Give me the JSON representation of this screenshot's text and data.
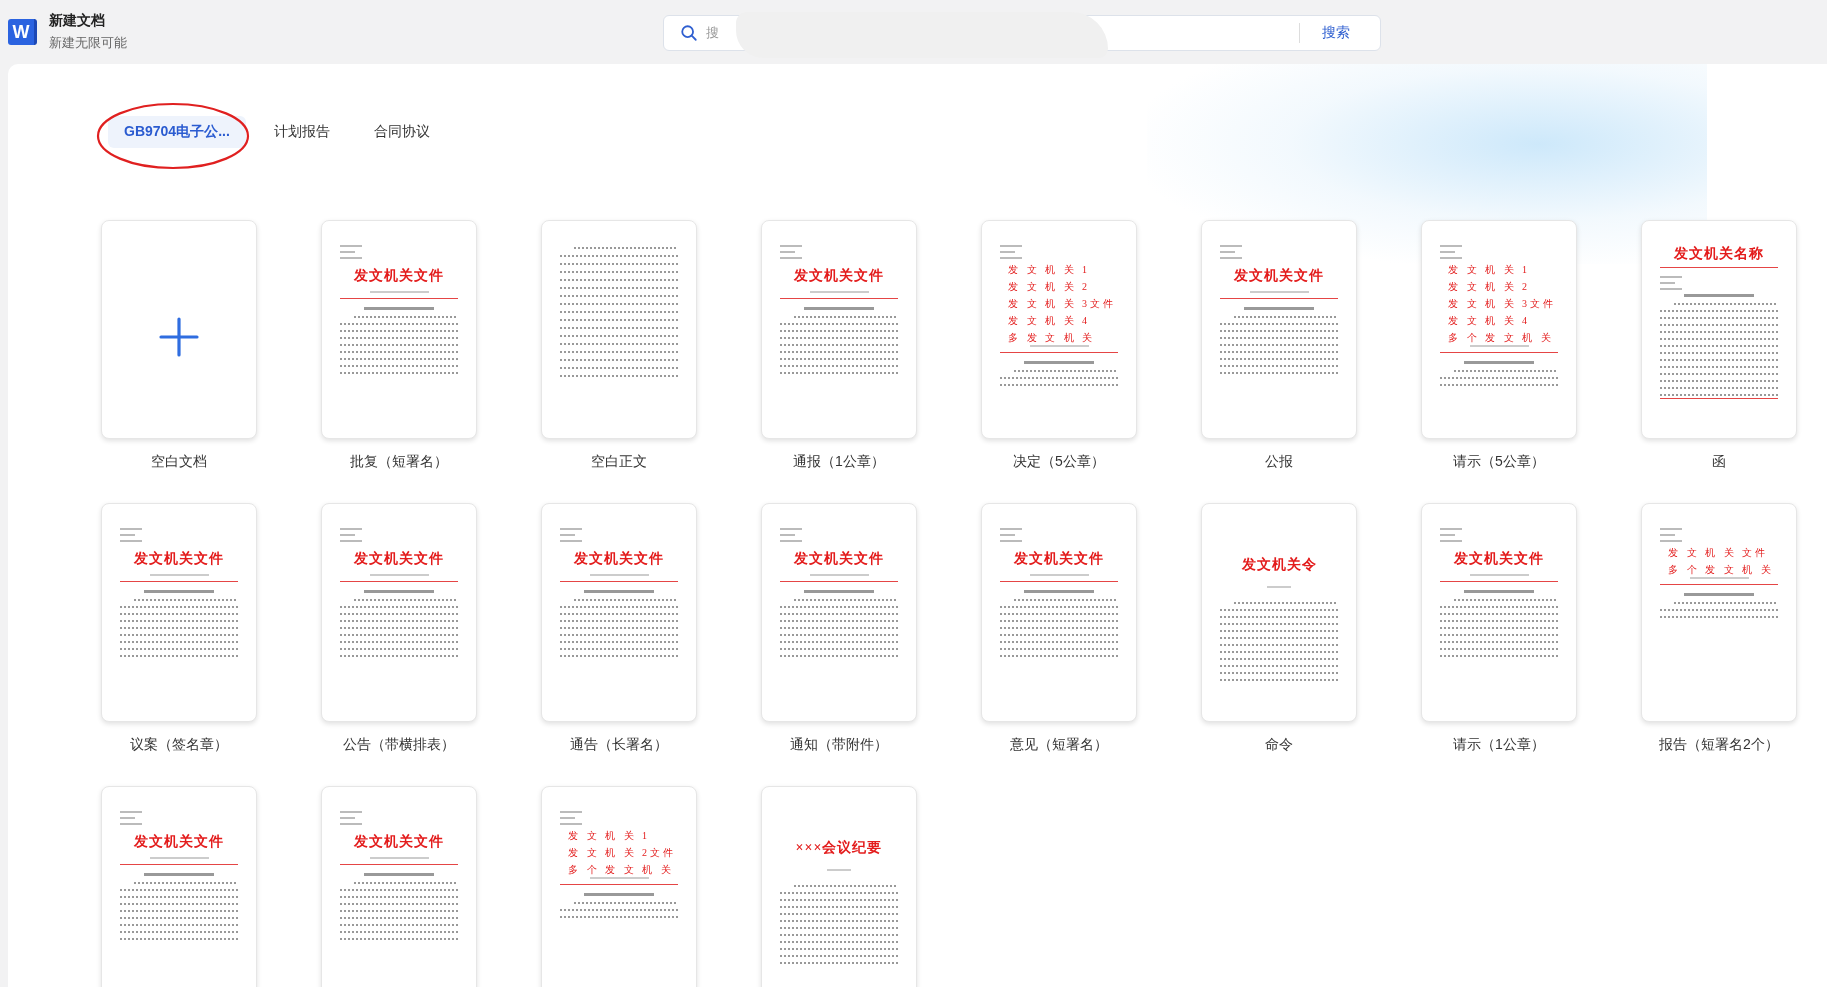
{
  "app": {
    "title": "新建文档",
    "subtitle": "新建无限可能",
    "logo": "W"
  },
  "search": {
    "placeholder": "搜",
    "button": "搜索"
  },
  "tabs": [
    {
      "label": "GB9704电子公...",
      "selected": true,
      "circled": true
    },
    {
      "label": "计划报告",
      "selected": false,
      "circled": false
    },
    {
      "label": "合同协议",
      "selected": false,
      "circled": false
    }
  ],
  "templates": [
    {
      "label": "空白文档",
      "preview": {
        "kind": "blank"
      }
    },
    {
      "label": "批复（短署名）",
      "preview": {
        "kind": "file",
        "heading": "发文机关文件"
      }
    },
    {
      "label": "空白正文",
      "preview": {
        "kind": "body"
      }
    },
    {
      "label": "通报（1公章）",
      "preview": {
        "kind": "file",
        "heading": "发文机关文件"
      }
    },
    {
      "label": "决定（5公章）",
      "preview": {
        "kind": "multi",
        "lines": [
          "发 文 机 关 1",
          "发 文 机 关 2",
          "发 文 机 关 3文件",
          "发 文 机 关 4",
          "多 发 文 机 关"
        ]
      }
    },
    {
      "label": "公报",
      "preview": {
        "kind": "file",
        "heading": "发文机关文件"
      }
    },
    {
      "label": "请示（5公章）",
      "preview": {
        "kind": "multi",
        "lines": [
          "发 文 机 关 1",
          "发 文 机 关 2",
          "发 文 机 关 3文件",
          "发 文 机 关 4",
          "多 个 发 文 机 关"
        ]
      }
    },
    {
      "label": "函",
      "preview": {
        "kind": "letter",
        "heading": "发文机关名称"
      }
    },
    {
      "label": "议案（签名章）",
      "preview": {
        "kind": "file",
        "heading": "发文机关文件"
      }
    },
    {
      "label": "公告（带横排表）",
      "preview": {
        "kind": "file",
        "heading": "发文机关文件"
      }
    },
    {
      "label": "通告（长署名）",
      "preview": {
        "kind": "file",
        "heading": "发文机关文件"
      }
    },
    {
      "label": "通知（带附件）",
      "preview": {
        "kind": "file",
        "heading": "发文机关文件"
      }
    },
    {
      "label": "意见（短署名）",
      "preview": {
        "kind": "file",
        "heading": "发文机关文件"
      }
    },
    {
      "label": "命令",
      "preview": {
        "kind": "order",
        "heading": "发文机关令"
      }
    },
    {
      "label": "请示（1公章）",
      "preview": {
        "kind": "file",
        "heading": "发文机关文件"
      }
    },
    {
      "label": "报告（短署名2个）",
      "preview": {
        "kind": "multi",
        "lines": [
          "发 文 机 关 文件",
          "多 个 发 文 机 关"
        ]
      }
    },
    {
      "preview": {
        "kind": "file",
        "heading": "发文机关文件"
      }
    },
    {
      "preview": {
        "kind": "file",
        "heading": "发文机关文件"
      }
    },
    {
      "preview": {
        "kind": "multi",
        "lines": [
          "发 文 机 关 1",
          "发 文 机 关 2文件",
          "多 个 发 文 机 关"
        ]
      }
    },
    {
      "preview": {
        "kind": "order",
        "heading": "×××会议纪要"
      }
    }
  ]
}
